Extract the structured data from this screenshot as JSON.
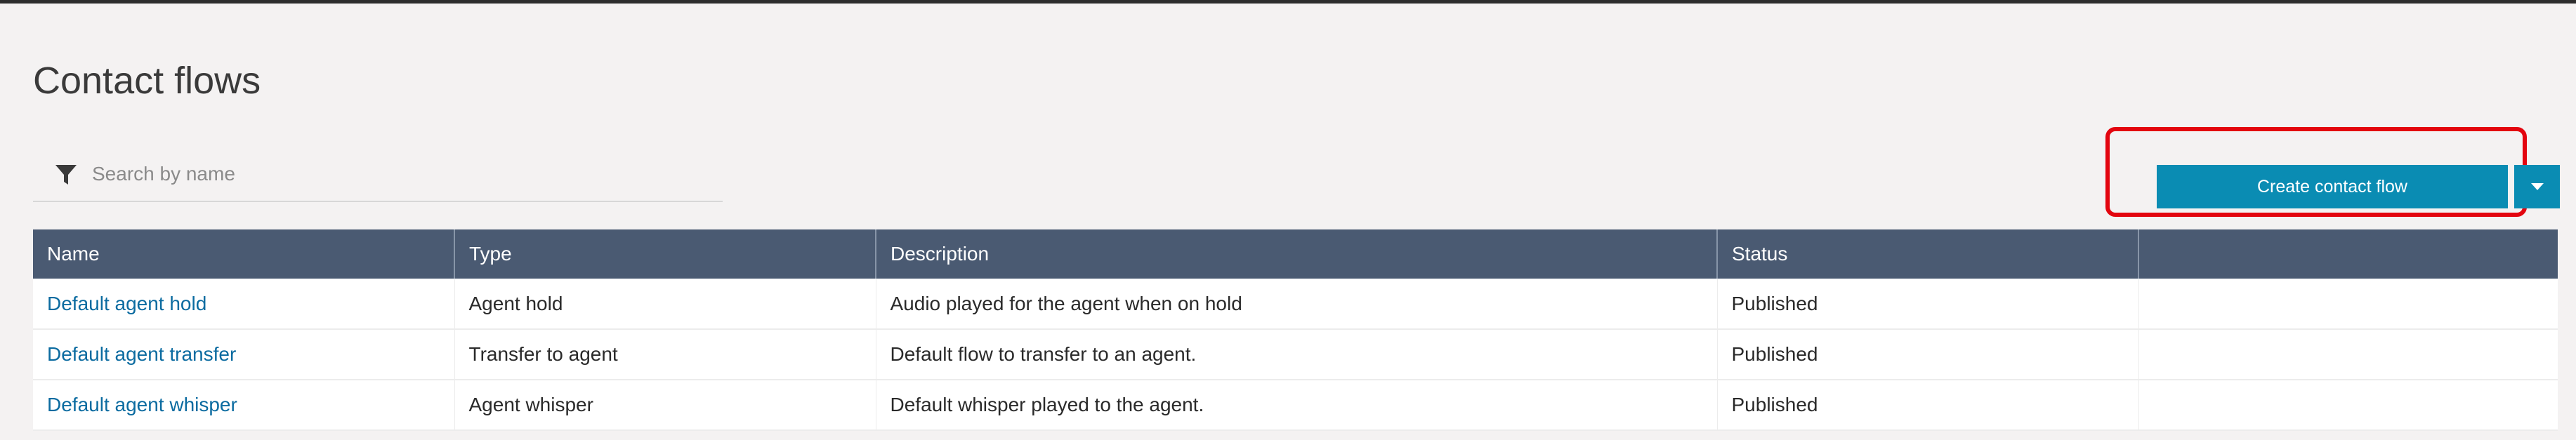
{
  "page": {
    "title": "Contact flows"
  },
  "search": {
    "placeholder": "Search by name",
    "value": ""
  },
  "actions": {
    "create_label": "Create contact flow"
  },
  "colors": {
    "primary": "#0a8cb3",
    "header_bg": "#4a5a72",
    "link": "#0b6ba0",
    "highlight": "#e3050f"
  },
  "icons": {
    "filter": "filter-icon",
    "dropdown": "caret-down-icon"
  },
  "table": {
    "columns": [
      "Name",
      "Type",
      "Description",
      "Status",
      ""
    ],
    "rows": [
      {
        "name": "Default agent hold",
        "type": "Agent hold",
        "description": "Audio played for the agent when on hold",
        "status": "Published"
      },
      {
        "name": "Default agent transfer",
        "type": "Transfer to agent",
        "description": "Default flow to transfer to an agent.",
        "status": "Published"
      },
      {
        "name": "Default agent whisper",
        "type": "Agent whisper",
        "description": "Default whisper played to the agent.",
        "status": "Published"
      }
    ]
  }
}
